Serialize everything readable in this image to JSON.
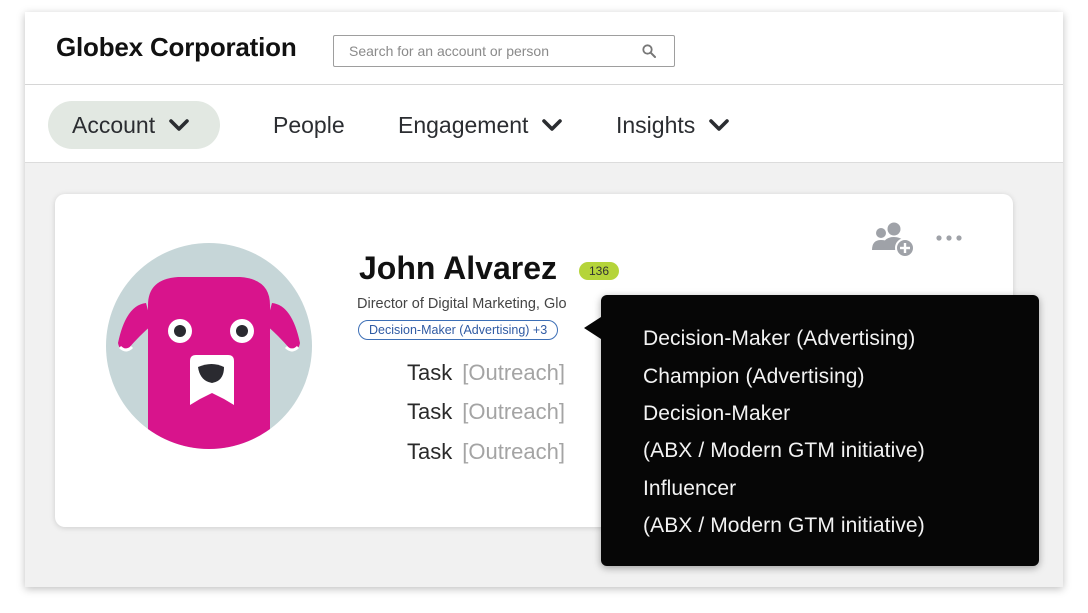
{
  "header": {
    "brand": "Globex Corporation",
    "search_placeholder": "Search for an account or person",
    "search_icon": "search-icon"
  },
  "nav": {
    "items": [
      {
        "label": "Account",
        "dropdown": true,
        "active": true
      },
      {
        "label": "People",
        "dropdown": false,
        "active": false
      },
      {
        "label": "Engagement",
        "dropdown": true,
        "active": false
      },
      {
        "label": "Insights",
        "dropdown": true,
        "active": false
      }
    ]
  },
  "profile": {
    "name": "John Alvarez",
    "score": "136",
    "title": "Director of Digital Marketing, Glo",
    "role_tag": "Decision-Maker (Advertising) +3",
    "avatar": "dog-avatar",
    "actions": {
      "add_icon": "add-person-icon",
      "more_icon": "more-options-icon"
    },
    "tasks": [
      {
        "label": "Task",
        "tag": "[Outreach]"
      },
      {
        "label": "Task",
        "tag": "[Outreach]"
      },
      {
        "label": "Task",
        "tag": "[Outreach]"
      }
    ]
  },
  "tooltip": {
    "lines": [
      "Decision-Maker (Advertising)",
      "Champion (Advertising)",
      "Decision-Maker",
      "(ABX / Modern GTM initiative)",
      "Influencer",
      "(ABX / Modern GTM initiative)"
    ]
  },
  "colors": {
    "avatar_bg": "#c6d6d8",
    "avatar_dog": "#d8148c",
    "score_badge": "#b5d43a",
    "tag_border": "#3d6fb6",
    "active_nav": "#e2e8e2",
    "tooltip_bg": "#060606"
  }
}
